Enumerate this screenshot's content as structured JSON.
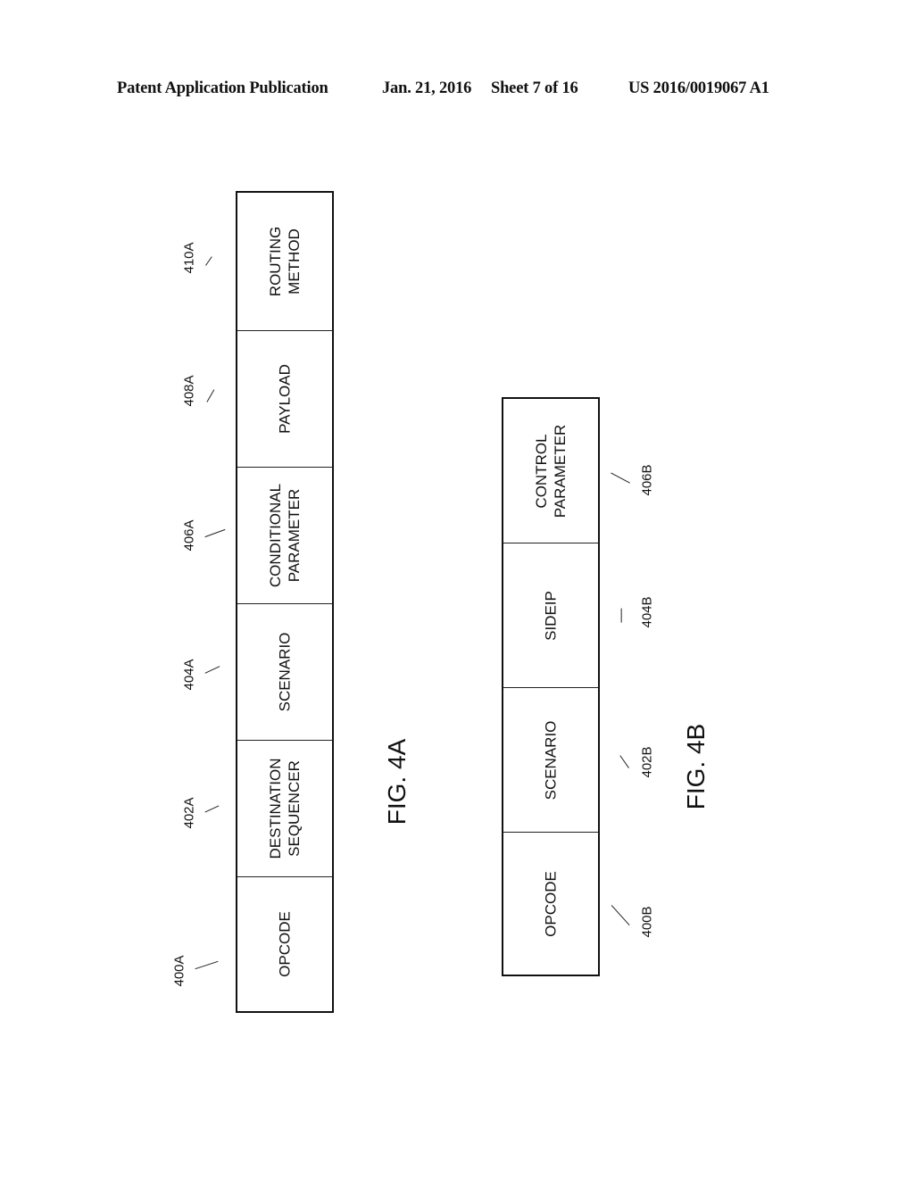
{
  "header": {
    "publication": "Patent Application Publication",
    "date": "Jan. 21, 2016",
    "sheet": "Sheet 7 of 16",
    "number": "US 2016/0019067 A1"
  },
  "fig4a": {
    "caption": "FIG. 4A",
    "fields": [
      {
        "ref": "400A",
        "label": "OPCODE"
      },
      {
        "ref": "402A",
        "label": "DESTINATION\nSEQUENCER"
      },
      {
        "ref": "404A",
        "label": "SCENARIO"
      },
      {
        "ref": "406A",
        "label": "CONDITIONAL\nPARAMETER"
      },
      {
        "ref": "408A",
        "label": "PAYLOAD"
      },
      {
        "ref": "410A",
        "label": "ROUTING\nMETHOD"
      }
    ]
  },
  "fig4b": {
    "caption": "FIG. 4B",
    "fields": [
      {
        "ref": "400B",
        "label": "OPCODE"
      },
      {
        "ref": "402B",
        "label": "SCENARIO"
      },
      {
        "ref": "404B",
        "label": "SIDEIP"
      },
      {
        "ref": "406B",
        "label": "CONTROL\nPARAMETER"
      }
    ]
  }
}
